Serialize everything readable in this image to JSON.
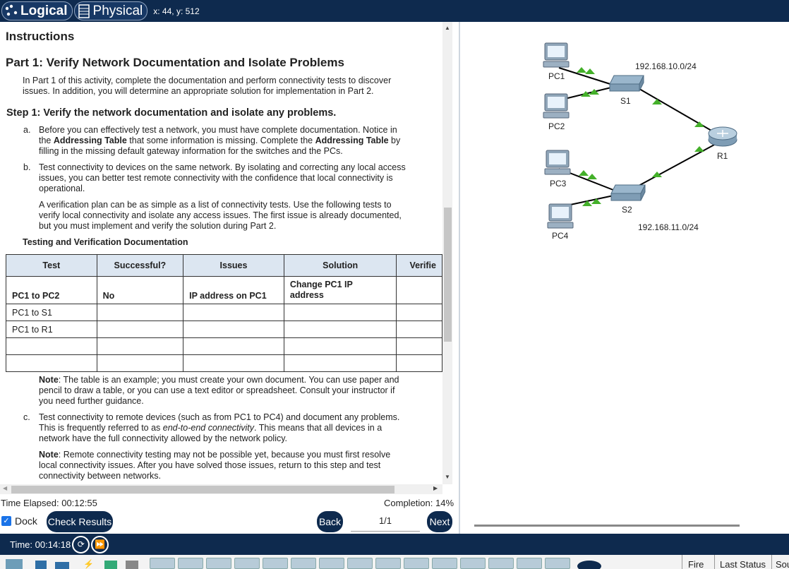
{
  "topbar": {
    "logical_label": "Logical",
    "physical_label": "Physical",
    "coords": "x: 44, y: 512"
  },
  "instructions": {
    "heading": "Instructions",
    "part_title": "Part 1: Verify Network Documentation and Isolate Problems",
    "part_intro_1": "In Part 1 of this activity, complete the documentation and perform connectivity tests to discover",
    "part_intro_2": "issues. In addition, you will determine an appropriate solution for implementation in Part 2.",
    "step_title": "Step 1: Verify the network documentation and isolate any problems.",
    "a_label": "a.",
    "a_line1": "Before you can effectively test a network, you must have complete documentation. Notice in",
    "a_line2_pre": "the ",
    "a_line2_bold": "Addressing Table",
    "a_line2_mid": " that some information is missing. Complete the ",
    "a_line2_bold2": "Addressing Table",
    "a_line2_post": " by",
    "a_line3": "filling in the missing default gateway information for the switches and the PCs.",
    "b_label": "b.",
    "b_line1": "Test connectivity to devices on the same network. By isolating and correcting any local access",
    "b_line2": "issues, you can better test remote connectivity with the confidence that local connectivity is",
    "b_line3": "operational.",
    "vp_line1": "A verification plan can be as simple as a list of connectivity tests. Use the following tests to",
    "vp_line2": "verify local connectivity and isolate any access issues. The first issue is already documented,",
    "vp_line3": "but you must implement and verify the solution during Part 2.",
    "table_title": "Testing and Verification Documentation",
    "table_headers": [
      "Test",
      "Successful?",
      "Issues",
      "Solution",
      "Verifie"
    ],
    "row1": [
      "PC1 to PC2",
      "No",
      "IP address on PC1",
      "Change PC1 IP",
      "address"
    ],
    "row2": [
      "PC1 to S1"
    ],
    "row3": [
      "PC1 to R1"
    ],
    "note1_bold": "Note",
    "note1_line1": ": The table is an example; you must create your own document. You can use paper and",
    "note1_line2": "pencil to draw a table, or you can use a text editor or spreadsheet. Consult your instructor if",
    "note1_line3": "you need further guidance.",
    "c_label": "c.",
    "c_line1": "Test connectivity to remote devices (such as from PC1 to PC4) and document any problems.",
    "c_line2_pre": "This is frequently referred to as ",
    "c_line2_em": "end-to-end connectivity",
    "c_line2_post": ". This means that all devices in a",
    "c_line3": "network have the full connectivity allowed by the network policy.",
    "note2_bold": "Note",
    "note2_line1": ": Remote connectivity testing may not be possible yet, because you must first resolve",
    "note2_line2": "local connectivity issues. After you have solved those issues, return to this step and test",
    "note2_line3": "connectivity between networks."
  },
  "footer": {
    "time_elapsed": "Time Elapsed: 00:12:55",
    "completion": "Completion: 14%",
    "dock_label": "Dock",
    "check_results": "Check Results",
    "back": "Back",
    "page": "1/1",
    "next": "Next"
  },
  "topology": {
    "pc1": "PC1",
    "pc2": "PC2",
    "pc3": "PC3",
    "pc4": "PC4",
    "s1": "S1",
    "s2": "S2",
    "r1": "R1",
    "net1": "192.168.10.0/24",
    "net2": "192.168.11.0/24",
    "link_color": "#000000",
    "status_color": "#44b02a"
  },
  "bottombar": {
    "time": "Time: 00:14:18",
    "fire": "Fire",
    "last_status": "Last Status",
    "sou": "Sou"
  }
}
